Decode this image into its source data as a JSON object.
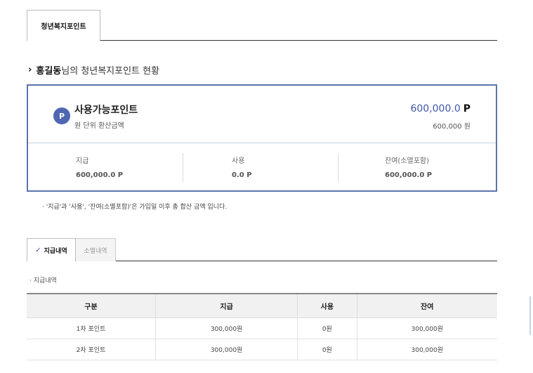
{
  "top_tab": {
    "label": "청년복지포인트"
  },
  "section": {
    "chevron": "›",
    "user_name": "홍길동",
    "title_suffix": "님의 청년복지포인트 현황"
  },
  "summary": {
    "badge": "P",
    "available_label": "사용가능포인트",
    "available_sub": "원 단위 환산금액",
    "available_points": "600,000.0",
    "available_unit": "P",
    "available_won": "600,000 원",
    "stats": [
      {
        "label": "지급",
        "value": "600,000.0  P"
      },
      {
        "label": "사용",
        "value": "0.0  P"
      },
      {
        "label": "잔여(소멸포함)",
        "value": "600,000.0  P"
      }
    ]
  },
  "note": "· '지급'과 '사용', '잔여(소멸포함)'은 가입일 이후 총 합산 금액 입니다.",
  "sub_tabs": {
    "active_check": "✓",
    "active_label": "지급내역",
    "inactive_label": "소멸내역"
  },
  "list_label": "· 지급내역",
  "table": {
    "headers": [
      "구분",
      "지급",
      "사용",
      "잔여"
    ],
    "rows": [
      [
        "1차 포인트",
        "300,000원",
        "0원",
        "300,000원"
      ],
      [
        "2차 포인트",
        "300,000원",
        "0원",
        "300,000원"
      ]
    ]
  },
  "colors": {
    "accent": "#4f67b0",
    "border": "#5b74ac"
  }
}
